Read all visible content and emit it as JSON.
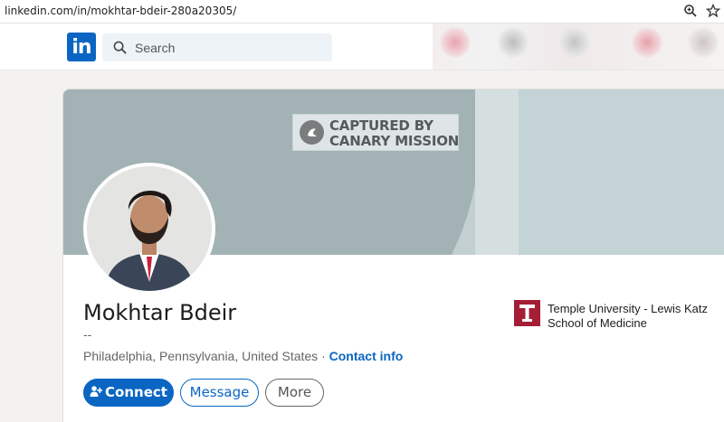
{
  "browser": {
    "url": "linkedin.com/in/mokhtar-bdeir-280a20305/",
    "zoom_icon": "zoom-icon",
    "star_icon": "star-icon"
  },
  "nav": {
    "logo_text": "in",
    "search_placeholder": "Search"
  },
  "watermark": {
    "line1": "CAPTURED BY",
    "line2": "CANARY MISSION"
  },
  "profile": {
    "name": "Mokhtar Bdeir",
    "headline": "--",
    "location": "Philadelphia, Pennsylvania, United States",
    "separator": " · ",
    "contact_label": "Contact info"
  },
  "actions": {
    "connect": "Connect",
    "message": "Message",
    "more": "More"
  },
  "education": {
    "line1": "Temple University - Lewis Katz",
    "line2": "School of Medicine"
  },
  "colors": {
    "brand": "#0a66c2",
    "temple": "#a41e35"
  }
}
